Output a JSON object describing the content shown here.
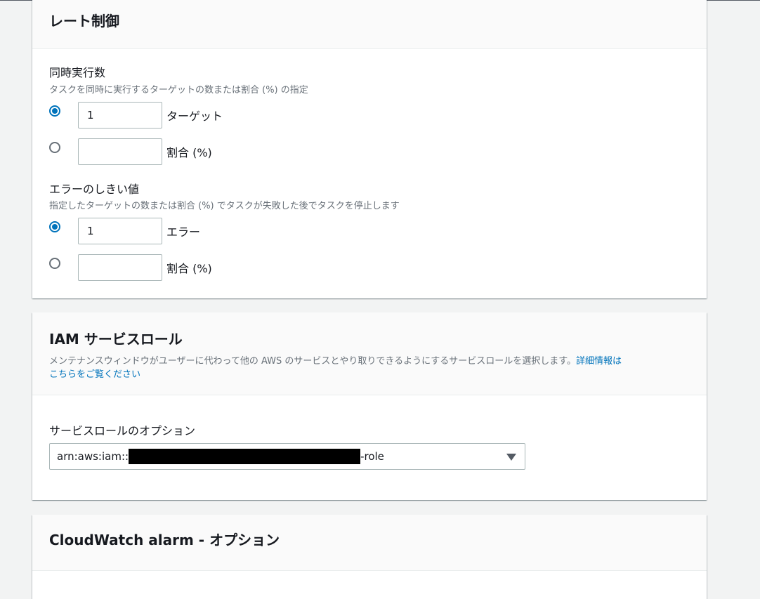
{
  "rate_control": {
    "title": "レート制御",
    "concurrency": {
      "label": "同時実行数",
      "description": "タスクを同時に実行するターゲットの数または割合 (%) の指定",
      "targets_value": "1",
      "targets_suffix": "ターゲット",
      "percent_value": "",
      "percent_suffix": "割合 (%)",
      "selected": "targets"
    },
    "error_threshold": {
      "label": "エラーのしきい値",
      "description": "指定したターゲットの数または割合 (%) でタスクが失敗した後でタスクを停止します",
      "errors_value": "1",
      "errors_suffix": "エラー",
      "percent_value": "",
      "percent_suffix": "割合 (%)",
      "selected": "errors"
    }
  },
  "iam_service_role": {
    "title": "IAM サービスロール",
    "description": "メンテナンスウィンドウがユーザーに代わって他の AWS のサービスとやり取りできるようにするサービスロールを選択します。",
    "link_text_line1": "詳細情報は",
    "link_text_line2": "こちらをご覧ください",
    "option_label": "サービスロールのオプション",
    "selected_role_prefix": "arn:aws:iam::",
    "selected_role_suffix": "-role"
  },
  "cloudwatch": {
    "title": "CloudWatch alarm - オプション"
  },
  "colors": {
    "accent": "#0073bb",
    "background": "#f2f3f3",
    "panel": "#ffffff",
    "border": "#aab7b8"
  }
}
